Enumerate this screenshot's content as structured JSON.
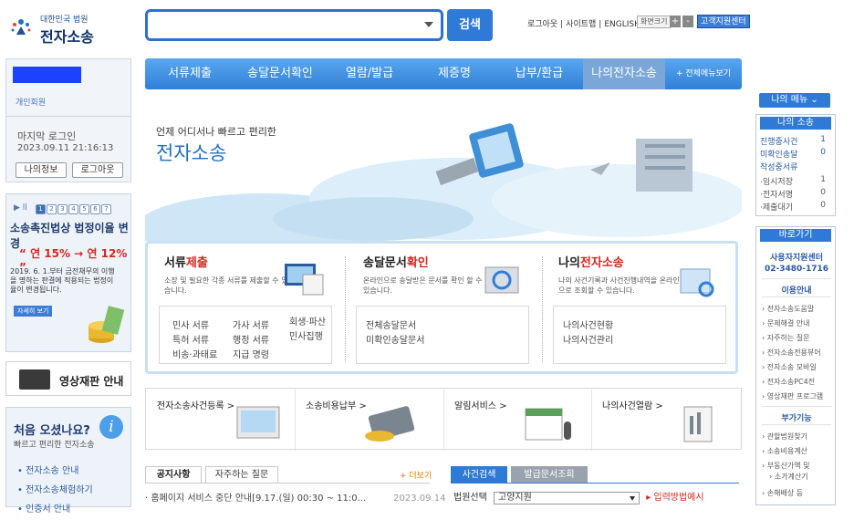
{
  "header": {
    "court_name": "대한민국 법원",
    "app_name": "전자소송",
    "search_button": "검색",
    "top_links": [
      "로그아웃",
      "|",
      "사이트맵",
      "|",
      "ENGLISH"
    ],
    "font_size_label": "화면크기",
    "zoom_in": "+",
    "zoom_out": "-",
    "help_center": "고객지원센터"
  },
  "nav": {
    "items": [
      "서류제출",
      "송달문서확인",
      "열람/발급",
      "제증명",
      "납부/환급",
      "나의전자소송"
    ],
    "more": "+ 전체메뉴보기"
  },
  "login": {
    "user_type": "개인회원",
    "last_login_label": "마지막 로그인",
    "last_login_date": "2023.09.11 21:16:13",
    "my_info_button": "나의정보",
    "logout_button": "로그아웃"
  },
  "banner": {
    "controls": "▶ ll",
    "pages": [
      "1",
      "2",
      "3",
      "4",
      "5",
      "6",
      "7"
    ],
    "title": "소송촉진법상 법정이율 변경",
    "rate": "“ 연 15% → 연 12% ”",
    "desc": "2019. 6. 1.부터 금전채무의 이행을 명하는 판결에 적용되는 법정이율이 변경됩니다.",
    "more_button": "자세히 보기"
  },
  "video": {
    "label": "영상재판 안내"
  },
  "first_visit": {
    "title": "처음 오셨나요?",
    "subtitle": "빠르고 편리한 전자소송",
    "links": [
      "전자소송 안내",
      "전자소송체험하기",
      "인증서 안내"
    ]
  },
  "hero": {
    "subtitle": "언제 어디서나 빠르고 편리한",
    "title": "전자소송"
  },
  "services": {
    "submit": {
      "title_a": "서류",
      "title_b": "제출",
      "desc": "소장 및 필요한 각종 서류를 제출할 수 있습니다.",
      "links": [
        "민사 서류",
        "가사 서류",
        "회생·파산",
        "특허 서류",
        "행정 서류",
        "민사집행",
        "비송·과태료",
        "지급 명령"
      ]
    },
    "delivery": {
      "title_a": "송달문서",
      "title_b": "확인",
      "desc": "온라인으로 송달받은 문서를 확인 할 수 있습니다.",
      "links": [
        "전체송달문서",
        "미확인송달문서"
      ]
    },
    "mycase": {
      "title_a": "나의",
      "title_b": "전자소송",
      "desc": "나의 사건기록과 사건진행내역을 온라인으로 조회할 수 있습니다.",
      "links": [
        "나의사건현황",
        "나의사건관리"
      ]
    }
  },
  "quick": [
    "전자소송사건등록 >",
    "소송비용납부 >",
    "알림서비스 >",
    "나의사건열람 >"
  ],
  "bottom": {
    "tab_notice": "공지사항",
    "tab_faq": "자주하는 질문",
    "more": "+ 더보기",
    "notice_text": "· 홈페이지 서비스 중단 안내[9.17.(일) 00:30 ~ 11:0...",
    "notice_date": "2023.09.14",
    "tab_case_search": "사건검색",
    "tab_issued": "발급문서조회",
    "court_label": "법원선택",
    "court_value": "고양지원",
    "input_method": "▸ 입력방법예시"
  },
  "right": {
    "my_menu": "나의 메뉴 ⌄",
    "my_case_title": "나의 소송",
    "my_case_rows": [
      {
        "label": "진행중사건",
        "count": "1"
      },
      {
        "label": "미확인송달",
        "count": "0"
      },
      {
        "label": "작성중서류",
        "count": ""
      },
      {
        "label": "·임시저장",
        "count": "1"
      },
      {
        "label": "·전자서명",
        "count": "0"
      },
      {
        "label": "·제출대기",
        "count": "0"
      }
    ],
    "shortcut_title": "바로가기",
    "contact_center": "사용자지원센터",
    "phone": "02-3480-1716",
    "usage_title": "이용안내",
    "usage_links": [
      "전자소송도움말",
      "문제해결 안내",
      "자주하는 질문",
      "전자소송전용뷰어",
      "전자소송 모바일",
      "전자소송PC4전",
      "영상재판 프로그램"
    ],
    "extra_title": "부가기능",
    "extra_links": [
      "관할법원찾기",
      "소송비용계산",
      "부동산가액 및",
      "소가계산기",
      "손해배상 등"
    ]
  },
  "colors": {
    "primary": "#2e7ad6",
    "accent_red": "#d9261c",
    "nav_active": "#7aa7d8"
  }
}
